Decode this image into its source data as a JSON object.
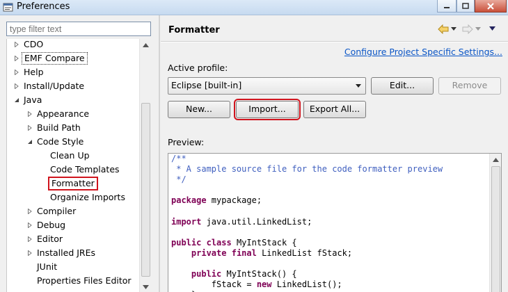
{
  "window": {
    "title": "Preferences"
  },
  "filter": {
    "placeholder": "type filter text"
  },
  "tree": {
    "items": [
      {
        "label": "CDO"
      },
      {
        "label": "EMF Compare"
      },
      {
        "label": "Help"
      },
      {
        "label": "Install/Update"
      },
      {
        "label": "Java"
      },
      {
        "label": "Appearance"
      },
      {
        "label": "Build Path"
      },
      {
        "label": "Code Style"
      },
      {
        "label": "Clean Up"
      },
      {
        "label": "Code Templates"
      },
      {
        "label": "Formatter"
      },
      {
        "label": "Organize Imports"
      },
      {
        "label": "Compiler"
      },
      {
        "label": "Debug"
      },
      {
        "label": "Editor"
      },
      {
        "label": "Installed JREs"
      },
      {
        "label": "JUnit"
      },
      {
        "label": "Properties Files Editor"
      }
    ]
  },
  "page": {
    "title": "Formatter",
    "configure_link": "Configure Project Specific Settings...",
    "active_profile_label": "Active profile:",
    "profile_value": "Eclipse [built-in]",
    "edit_button": "Edit...",
    "remove_button": "Remove",
    "new_button": "New...",
    "import_button": "Import...",
    "export_button": "Export All...",
    "preview_label": "Preview:"
  },
  "code_preview": {
    "lines": [
      "/**",
      " * A sample source file for the code formatter preview",
      " */",
      "",
      "package mypackage;",
      "",
      "import java.util.LinkedList;",
      "",
      "public class MyIntStack {",
      "    private final LinkedList fStack;",
      "",
      "    public MyIntStack() {",
      "        fStack = new LinkedList();",
      "    }"
    ]
  },
  "colors": {
    "highlight": "#d0141d",
    "link": "#0a55c6",
    "keyword": "#7f0055",
    "comment": "#3f5fbf"
  }
}
